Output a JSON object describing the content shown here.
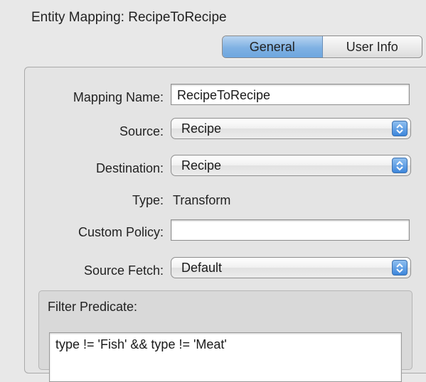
{
  "inspector": {
    "title": "Entity Mapping: RecipeToRecipe"
  },
  "tabs": [
    {
      "label": "General",
      "selected": true
    },
    {
      "label": "User Info",
      "selected": false
    }
  ],
  "form": {
    "mapping_name_label": "Mapping Name:",
    "mapping_name_value": "RecipeToRecipe",
    "source_label": "Source:",
    "source_value": "Recipe",
    "destination_label": "Destination:",
    "destination_value": "Recipe",
    "type_label": "Type:",
    "type_value": "Transform",
    "custom_policy_label": "Custom Policy:",
    "custom_policy_value": "",
    "source_fetch_label": "Source Fetch:",
    "source_fetch_value": "Default"
  },
  "filter": {
    "title": "Filter Predicate:",
    "value": "type != 'Fish' && type != 'Meat'"
  },
  "icons": {
    "popup_arrows": "up-down-chevron-icon"
  },
  "colors": {
    "selected_tab": "#7fb1e3",
    "popup_arrow": "#3d86db"
  }
}
